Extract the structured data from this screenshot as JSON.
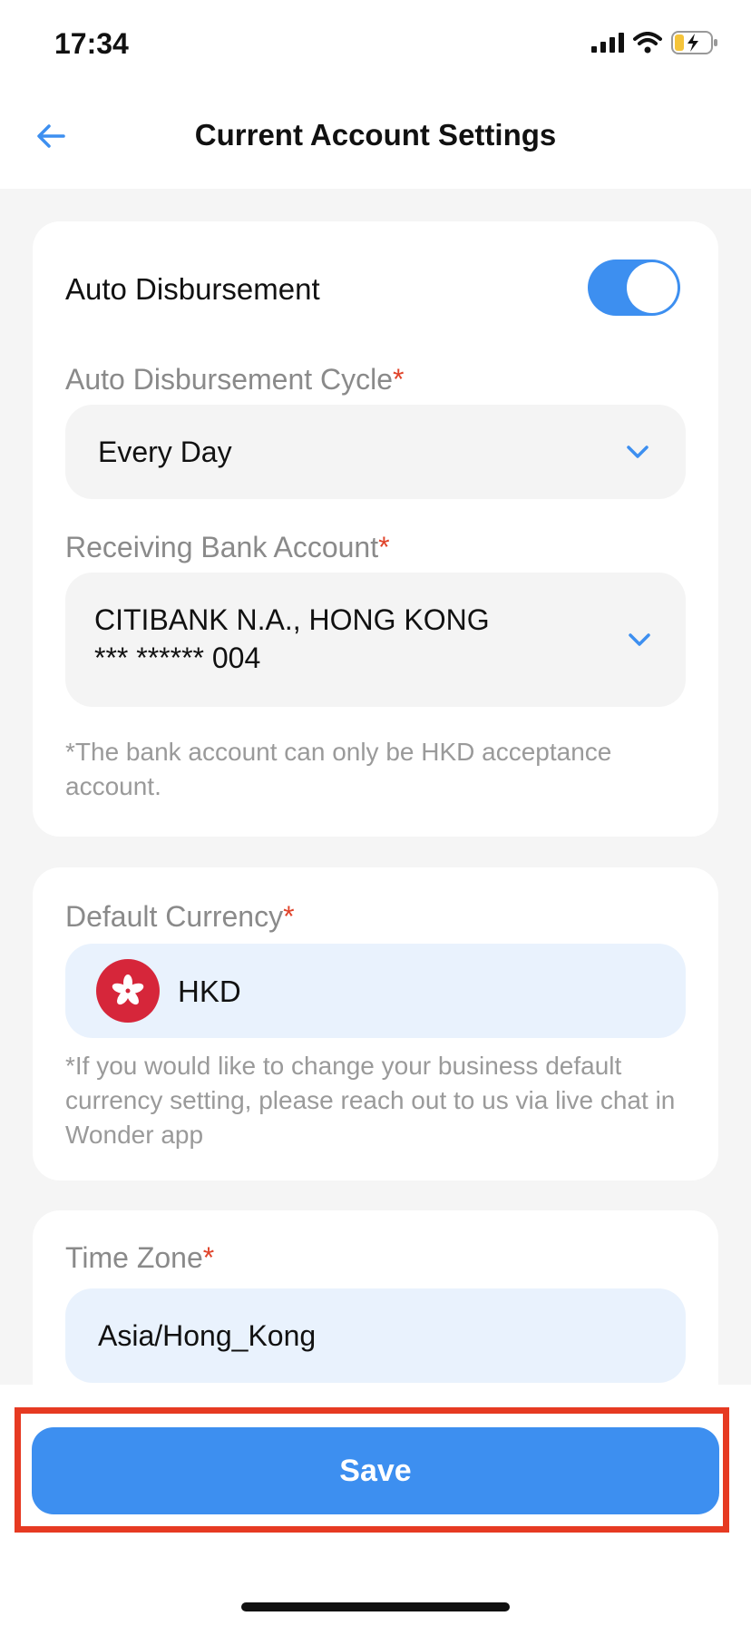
{
  "status_bar": {
    "time": "17:34"
  },
  "header": {
    "title": "Current Account Settings"
  },
  "auto_disbursement": {
    "label": "Auto Disbursement",
    "enabled": true,
    "cycle_label": "Auto Disbursement Cycle",
    "cycle_value": "Every Day",
    "bank_label": "Receiving Bank Account",
    "bank_name": "CITIBANK N.A., HONG KONG",
    "bank_number": "*** ****** 004",
    "bank_note": "*The bank account can only be HKD acceptance account."
  },
  "currency": {
    "label": "Default Currency",
    "value": "HKD",
    "note": "*If you would like to change your business default currency setting, please reach out to us via live chat in Wonder app"
  },
  "time_zone": {
    "label": "Time Zone",
    "value": "Asia/Hong_Kong"
  },
  "required_mark": "*",
  "save_button": {
    "label": "Save"
  },
  "colors": {
    "accent": "#3d8ff0",
    "required": "#e0442b",
    "highlight": "#e63a22",
    "flag": "#d6263a"
  }
}
